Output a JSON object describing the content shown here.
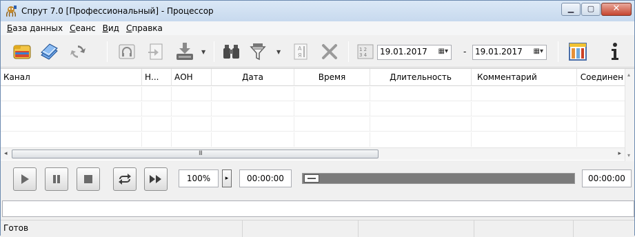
{
  "window": {
    "title": "Спрут 7.0 [Профессиональный] - Процессор",
    "minimize_glyph": "▁",
    "maximize_glyph": "▢",
    "close_glyph": "✕"
  },
  "menu": {
    "items": [
      {
        "label": "База данных",
        "mnemonic": "Б",
        "rest": "аза данных"
      },
      {
        "label": "Сеанс",
        "mnemonic": "С",
        "rest": "еанс"
      },
      {
        "label": "Вид",
        "mnemonic": "В",
        "rest": "ид"
      },
      {
        "label": "Справка",
        "mnemonic": "С",
        "rest": "правка"
      }
    ]
  },
  "toolbar": {
    "date_from": "19.01.2017",
    "date_to": "19.01.2017",
    "date_dash": "-",
    "date_dropdown_glyph": "▦▾"
  },
  "grid": {
    "columns": [
      "Канал",
      "Н...",
      "АОН",
      "Дата",
      "Время",
      "Длительность",
      "Комментарий",
      "Соединен"
    ],
    "hscroll_grip": "III",
    "scroll_left": "◂",
    "scroll_right": "▸",
    "scroll_up": "▴",
    "scroll_down": "▾"
  },
  "player": {
    "zoom": "100%",
    "zoom_arrow": "▸",
    "time_start": "00:00:00",
    "time_end": "00:00:00",
    "position_fraction": 0
  },
  "status": {
    "text": "Готов"
  },
  "colors": {
    "accent": "#2a6fb8",
    "close_button": "#c64630"
  }
}
